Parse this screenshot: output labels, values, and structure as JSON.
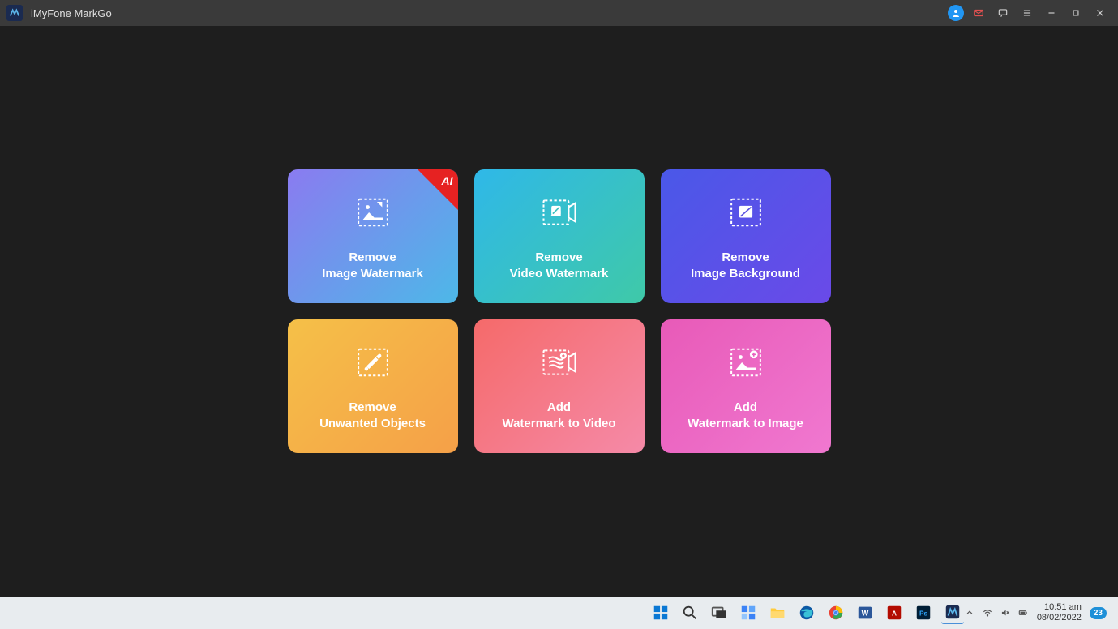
{
  "titlebar": {
    "app_name": "iMyFone MarkGo"
  },
  "cards": [
    {
      "line1": "Remove",
      "line2": "Image Watermark",
      "ai_badge": "AI"
    },
    {
      "line1": "Remove",
      "line2": "Video Watermark"
    },
    {
      "line1": "Remove",
      "line2": "Image Background"
    },
    {
      "line1": "Remove",
      "line2": "Unwanted Objects"
    },
    {
      "line1": "Add",
      "line2": "Watermark to Video"
    },
    {
      "line1": "Add",
      "line2": "Watermark to Image"
    }
  ],
  "taskbar": {
    "time": "10:51 am",
    "date": "08/02/2022",
    "notif_count": "23"
  }
}
